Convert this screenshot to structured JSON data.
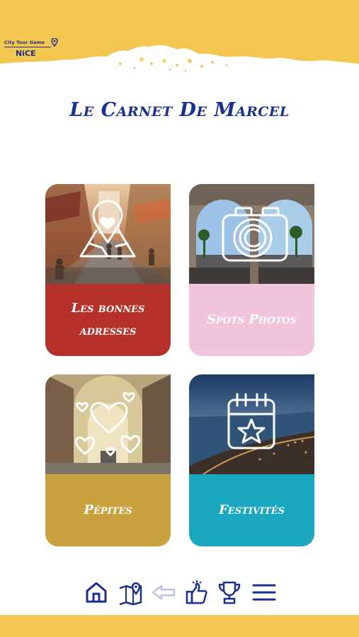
{
  "brand": {
    "line1": "City Tour Game",
    "city": "NiCE"
  },
  "page_title": "Le Carnet De Marcel",
  "cards": [
    {
      "label": "Les bonnes adresses",
      "icon": "map-pin-heart-icon",
      "band_color": "#b5312a"
    },
    {
      "label": "Spots Photos",
      "icon": "camera-icon",
      "band_color": "#f1c4dc"
    },
    {
      "label": "Pépites",
      "icon": "hearts-icon",
      "band_color": "#c9a13e"
    },
    {
      "label": "Festivités",
      "icon": "calendar-star-icon",
      "band_color": "#1aa7bf"
    }
  ],
  "nav": [
    {
      "icon": "home-icon"
    },
    {
      "icon": "map-icon"
    },
    {
      "icon": "back-arrow-icon"
    },
    {
      "icon": "thumbs-up-icon"
    },
    {
      "icon": "trophy-icon"
    },
    {
      "icon": "menu-icon"
    }
  ],
  "colors": {
    "accent_yellow": "#f3c64f",
    "navy": "#1b2f93"
  }
}
